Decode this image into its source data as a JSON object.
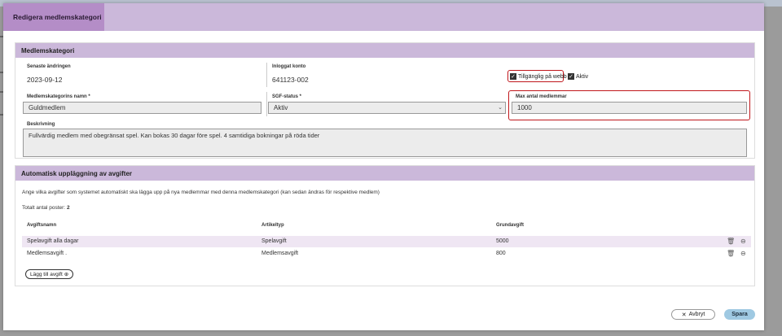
{
  "modal": {
    "title": "Redigera medlemskategori"
  },
  "category": {
    "section_title": "Medlemskategori",
    "last_changed_label": "Senaste ändringen",
    "last_changed_value": "2023-09-12",
    "logged_in_label": "Inloggat konto",
    "logged_in_value": "641123-002",
    "web_available_label": "Tillgänglig på webb",
    "active_label": "Aktiv",
    "name_label": "Medlemskategorins namn *",
    "name_value": "Guldmedlem",
    "sgf_label": "SGF-status *",
    "sgf_value": "Aktiv",
    "max_members_label": "Max antal medlemmar",
    "max_members_value": "1000",
    "description_label": "Beskrivning",
    "description_value": "Fullvärdig medlem med obegränsat spel. Kan bokas 30 dagar före spel. 4 samtidiga bokningar på röda tider"
  },
  "fees": {
    "section_title": "Automatisk uppläggning av avgifter",
    "intro": "Ange vilka avgifter som systemet automatiskt ska lägga upp på nya medlemmar med denna medlemskategori (kan sedan ändras för respektive medlem)",
    "total_label": "Totalt antal poster:",
    "total_value": "2",
    "columns": [
      "Avgiftsnamn",
      "Artikeltyp",
      "Grundavgift"
    ],
    "rows": [
      {
        "name": "Spelavgift alla dagar",
        "type": "Spelavgift",
        "amount": "5000"
      },
      {
        "name": "Medlemsavgift .",
        "type": "Medlemsavgift",
        "amount": "800"
      }
    ],
    "add_label": "Lägg till avgift"
  },
  "footer": {
    "cancel_label": "Avbryt",
    "save_label": "Spara"
  },
  "icons": {
    "checkbox": "check-icon",
    "delete": "trash-icon",
    "remove": "minus-circle-icon",
    "add": "plus-circle-icon",
    "close": "close-icon",
    "dropdown": "chevron-down-icon"
  },
  "colors": {
    "header_bg": "#cbb8da",
    "tab_bg": "#b48dc7",
    "highlight_border": "#c0171c",
    "save_button": "#9fc9e2"
  }
}
